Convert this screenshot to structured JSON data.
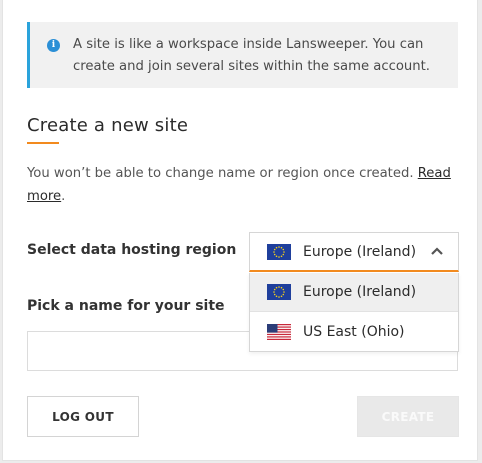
{
  "info": {
    "text": "A site is like a workspace inside Lansweeper. You can create and join several sites within the same account."
  },
  "form": {
    "title": "Create a new site",
    "description": "You won’t be able to change name or region once created.",
    "read_more": "Read more",
    "read_more_suffix": ".",
    "region_label": "Select data hosting region",
    "name_label": "Pick a name for your site",
    "name_value": ""
  },
  "region_select": {
    "selected": "Europe (Ireland)",
    "options": [
      {
        "label": "Europe (Ireland)",
        "flag": "eu-flag"
      },
      {
        "label": "US East (Ohio)",
        "flag": "us-flag"
      }
    ]
  },
  "buttons": {
    "logout": "LOG OUT",
    "create": "CREATE"
  },
  "colors": {
    "accent": "#f28a1e",
    "info_border": "#2aa3db",
    "info_icon": "#2b8fd6"
  }
}
